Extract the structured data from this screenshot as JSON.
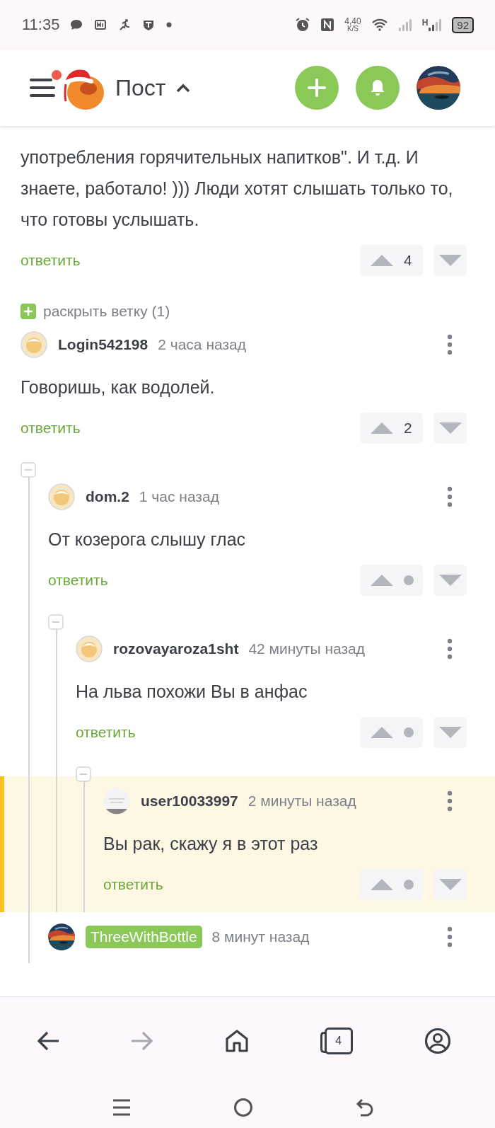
{
  "status_bar": {
    "time": "11:35",
    "network_speed": "4,40",
    "network_speed_unit": "K/S",
    "network_type": "H",
    "battery": "92"
  },
  "header": {
    "title": "Пост",
    "menu_badge": true,
    "expanded": true
  },
  "thread": {
    "partial_comment": {
      "text": "употребления горячительных напитков\". И т.д. И знаете, работало! ))) Люди хотят слышать только то, что готовы услышать.",
      "reply": "ответить",
      "vote": {
        "hidden": false,
        "score": "4"
      }
    },
    "expand_branch": {
      "label": "раскрыть ветку (1)"
    },
    "comments": [
      {
        "author": "Login542198",
        "author_badge": false,
        "avatar": {
          "kind": "default"
        },
        "time": "2 часа назад",
        "text": "Говоришь, как водолей.",
        "reply": "ответить",
        "vote": {
          "hidden": false,
          "score": "2"
        },
        "highlighted": false,
        "children": [
          {
            "author": "dom.2",
            "author_badge": false,
            "avatar": {
              "kind": "default"
            },
            "time": "1 час назад",
            "text": "От козерога слышу глас",
            "reply": "ответить",
            "vote": {
              "hidden": true
            },
            "highlighted": false,
            "children": [
              {
                "author": "rozovayaroza1sht",
                "author_badge": false,
                "avatar": {
                  "kind": "default"
                },
                "time": "42 минуты назад",
                "text": "На льва похожи Вы в анфас",
                "reply": "ответить",
                "vote": {
                  "hidden": true
                },
                "highlighted": false,
                "children": [
                  {
                    "author": "user10033997",
                    "author_badge": false,
                    "time": "2 минуты назад",
                    "text": "Вы рак, скажу я в этот раз",
                    "reply": "ответить",
                    "vote": {
                      "hidden": true
                    },
                    "highlighted": true
                  }
                ]
              }
            ]
          },
          {
            "author": "ThreeWithBottle",
            "author_badge": true,
            "time": "8 минут назад",
            "highlighted": false
          }
        ]
      }
    ]
  },
  "bottom_nav": {
    "tab_count": "4",
    "forward_disabled": true
  }
}
